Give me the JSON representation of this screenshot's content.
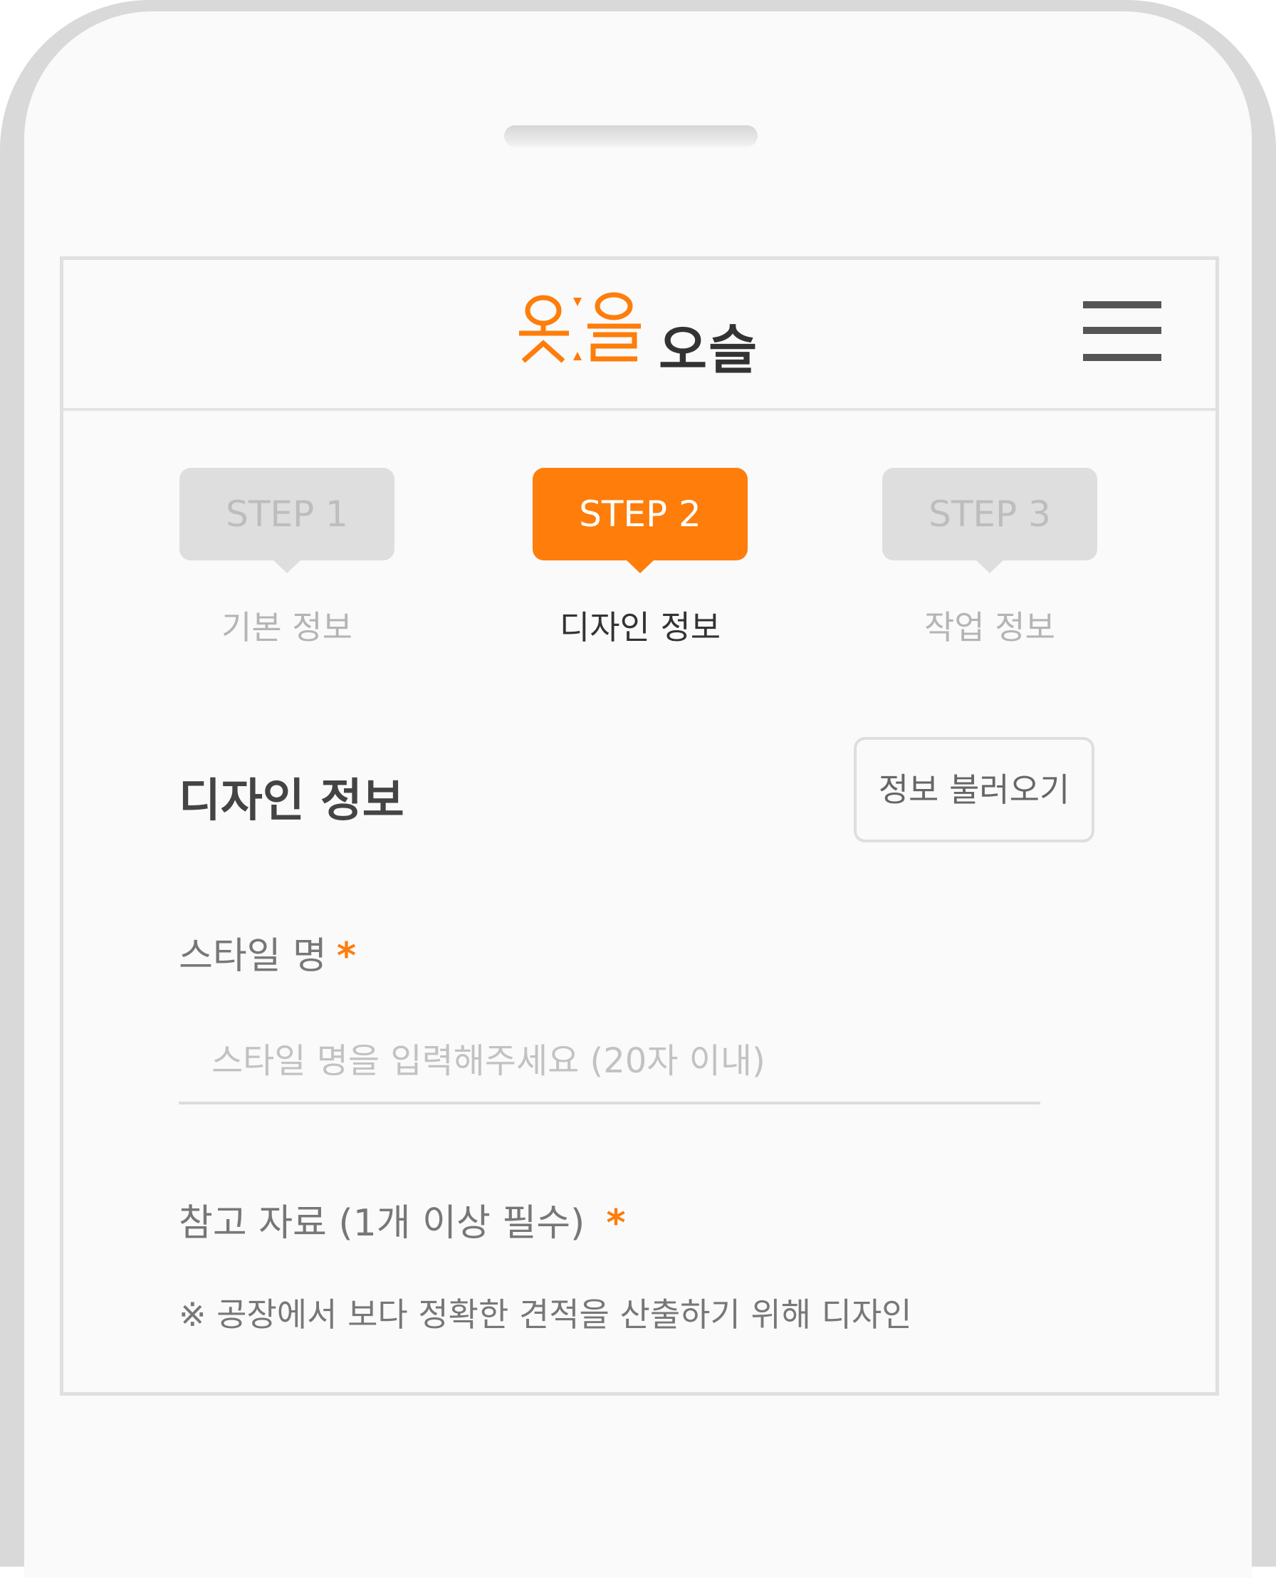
{
  "brand": {
    "logo_text": "오슬",
    "logo_mark_alt": "옷을"
  },
  "colors": {
    "accent": "#fe7d0b",
    "frame": "#d9d9d9",
    "screen_bg": "#fafafa"
  },
  "header": {
    "menu_icon": "hamburger-menu-icon"
  },
  "steps": [
    {
      "badge": "STEP 1",
      "label": "기본 정보",
      "active": false
    },
    {
      "badge": "STEP 2",
      "label": "디자인 정보",
      "active": true
    },
    {
      "badge": "STEP 3",
      "label": "작업 정보",
      "active": false
    }
  ],
  "section": {
    "title": "디자인 정보",
    "load_button": "정보 불러오기"
  },
  "form": {
    "style_name_label": "스타일 명",
    "required_mark": "*",
    "style_name_placeholder": "스타일 명을 입력해주세요 (20자 이내)",
    "style_name_value": "",
    "reference_label": "참고 자료 (1개 이상 필수)",
    "reference_notice": "※ 공장에서 보다 정확한 견적을 산출하기 위해 디자인"
  }
}
